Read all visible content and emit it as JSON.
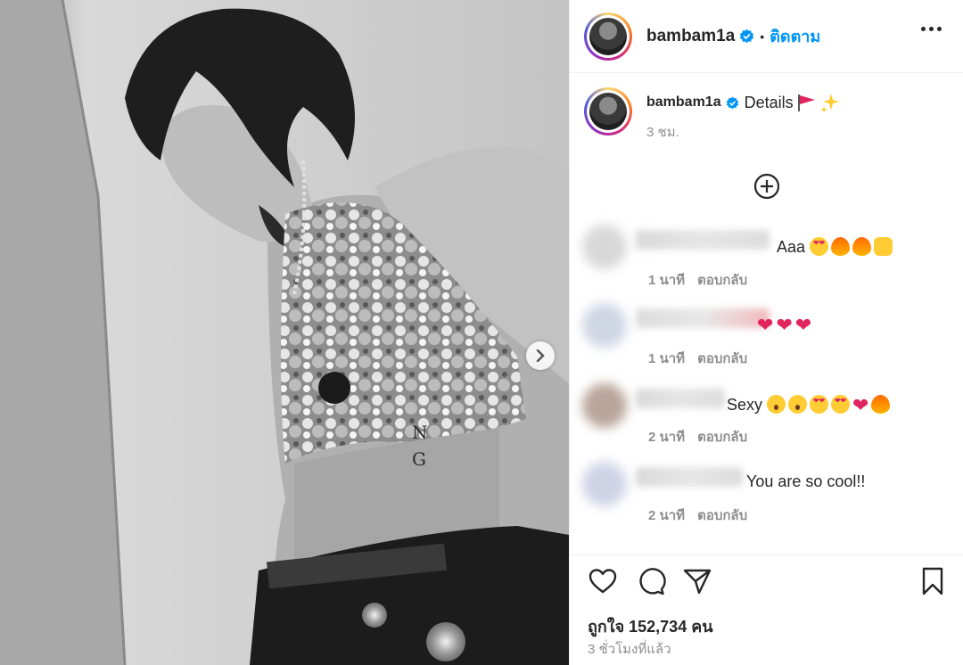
{
  "post": {
    "username": "bambam1a",
    "follow_label": "ติดตาม",
    "separator": "•",
    "caption": "Details",
    "caption_emojis": [
      "red-flag",
      "sparkles"
    ],
    "caption_time": "3 ชม.",
    "likes": "ถูกใจ 152,734 คน",
    "posted_ago": "3 ชั่วโมงที่แล้ว"
  },
  "comments": [
    {
      "text": "Aaa",
      "emojis": [
        "heart-eyes",
        "fire",
        "fire",
        "raising-hands"
      ],
      "time": "1 นาที",
      "reply": "ตอบกลับ"
    },
    {
      "text": "",
      "emojis": [
        "heart",
        "heart",
        "heart"
      ],
      "time": "1 นาที",
      "reply": "ตอบกลับ"
    },
    {
      "text": "Sexy",
      "emojis": [
        "wow",
        "wow",
        "heart-eyes",
        "heart-eyes",
        "heart",
        "fire"
      ],
      "time": "2 นาที",
      "reply": "ตอบกลับ"
    },
    {
      "text": "You are so cool!!",
      "emojis": [],
      "time": "2 นาที",
      "reply": "ตอบกลับ"
    }
  ],
  "icons": {
    "like": "heart-outline-icon",
    "comment": "speech-bubble-icon",
    "share": "paper-plane-icon",
    "save": "bookmark-icon",
    "more": "ellipsis-icon",
    "load_more": "plus-circle-icon",
    "next": "chevron-right-icon"
  },
  "colors": {
    "link": "#0095f6",
    "text": "#262626",
    "muted": "#8e8e8e",
    "verified": "#0095f6"
  }
}
